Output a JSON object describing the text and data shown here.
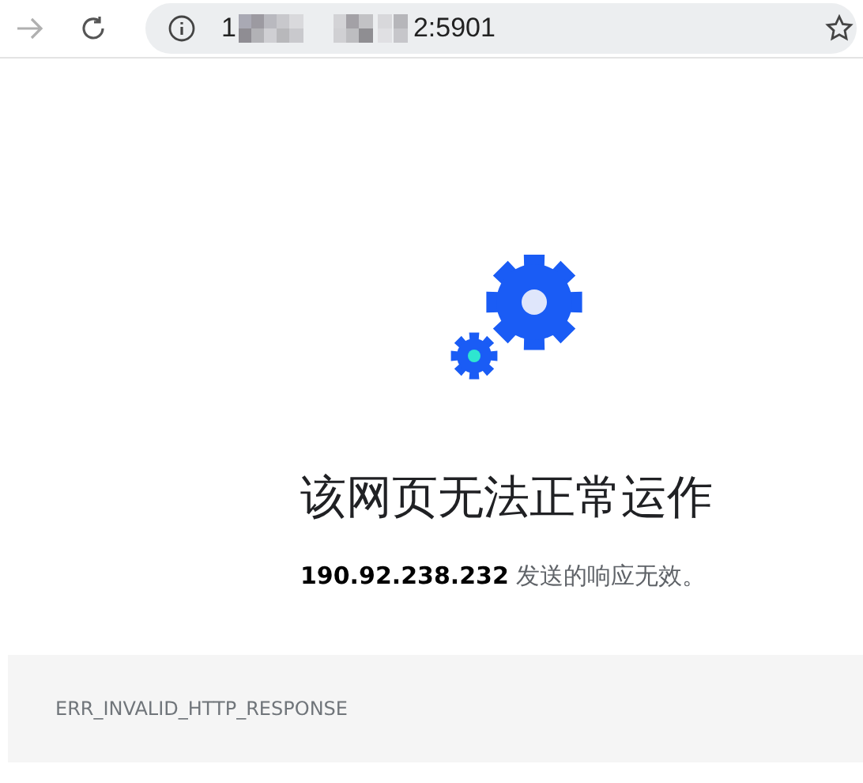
{
  "toolbar": {
    "address": {
      "prefix": "1",
      "suffix": "2:5901"
    }
  },
  "error": {
    "title": "该网页无法正常运作",
    "message": "**190.92.238.232** 发送的响应无效。",
    "code": "ERR_INVALID_HTTP_RESPONSE"
  }
}
